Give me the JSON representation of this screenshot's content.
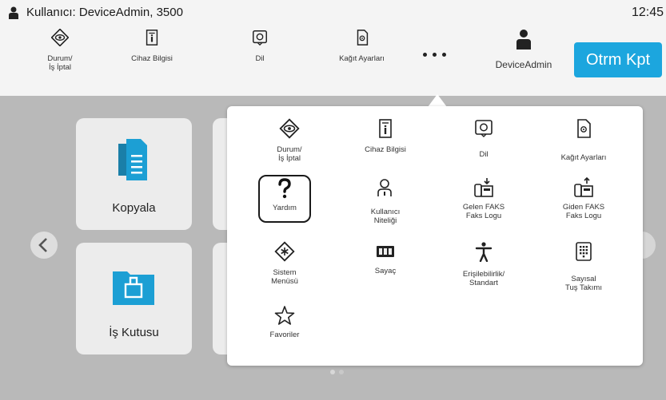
{
  "status_bar": {
    "user_text": "Kullanıcı: DeviceAdmin, 3500",
    "time": "12:45"
  },
  "toolbar": {
    "status_line1": "Durum/",
    "status_line2": "İş İptal",
    "device_info": "Cihaz Bilgisi",
    "language": "Dil",
    "paper_settings": "Kağıt Ayarları",
    "user": "DeviceAdmin",
    "logout": "Otrm Kpt"
  },
  "home": {
    "tiles": [
      {
        "label": "Kopyala",
        "icon": "copy-icon"
      },
      {
        "label": "İş Kutusu",
        "icon": "job-box-icon"
      }
    ],
    "page_count": 2,
    "current_page": 1
  },
  "popup_menu": {
    "items": [
      {
        "line1": "Durum/",
        "line2": "İş İptal",
        "icon": "status-eye-icon"
      },
      {
        "line1": "Cihaz Bilgisi",
        "line2": "",
        "icon": "device-info-icon"
      },
      {
        "line1": "Dil",
        "line2": "",
        "icon": "language-icon"
      },
      {
        "line1": "Kağıt Ayarları",
        "line2": "",
        "icon": "paper-settings-icon"
      },
      {
        "line1": "Yardım",
        "line2": "",
        "icon": "help-icon"
      },
      {
        "line1": "Kullanıcı",
        "line2": "Niteliği",
        "icon": "user-property-icon"
      },
      {
        "line1": "Gelen FAKS",
        "line2": "Faks Logu",
        "icon": "incoming-fax-icon"
      },
      {
        "line1": "Giden FAKS",
        "line2": "Faks Logu",
        "icon": "outgoing-fax-icon"
      },
      {
        "line1": "Sistem",
        "line2": "Menüsü",
        "icon": "system-menu-icon"
      },
      {
        "line1": "Sayaç",
        "line2": "",
        "icon": "counter-icon"
      },
      {
        "line1": "Erişilebilirlik/",
        "line2": "Standart",
        "icon": "accessibility-icon"
      },
      {
        "line1": "Sayısal",
        "line2": "Tuş Takımı",
        "icon": "keypad-icon"
      },
      {
        "line1": "Favoriler",
        "line2": "",
        "icon": "favorites-star-icon"
      }
    ],
    "highlighted_item": "Yardım"
  },
  "colors": {
    "accent": "#1ca6de",
    "home_background": "#b9b9b9",
    "header_background": "#f4f4f4"
  }
}
